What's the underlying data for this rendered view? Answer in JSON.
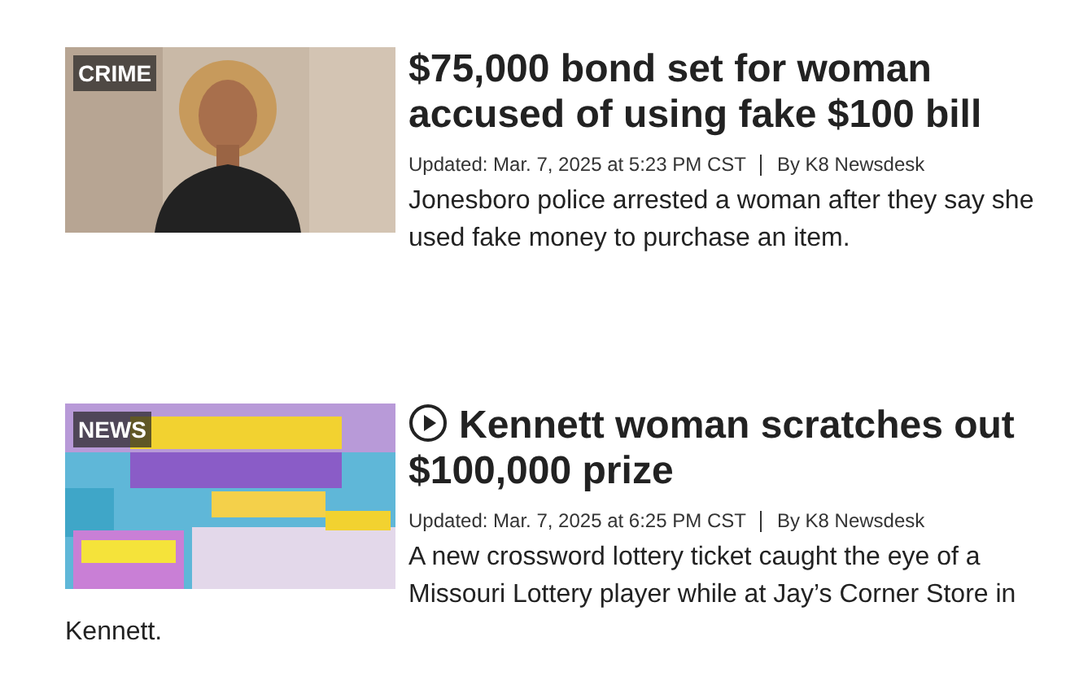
{
  "articles": [
    {
      "badge": "CRIME",
      "video": false,
      "title": "$75,000 bond set for woman accused of using fake $100 bill",
      "updated": "Updated: Mar. 7, 2025 at 5:23 PM CST",
      "byline": "By K8 Newsdesk",
      "summary": "Jonesboro police arrested a woman after they say she used fake money to purchase an item."
    },
    {
      "badge": "NEWS",
      "video": true,
      "title": "Kennett woman scratches out $100,000 prize",
      "updated": "Updated: Mar. 7, 2025 at 6:25 PM CST",
      "byline": "By K8 Newsdesk",
      "summary": "A new crossword lottery ticket caught the eye of a Missouri Lottery player while at Jay’s Corner Store in Kennett."
    }
  ]
}
